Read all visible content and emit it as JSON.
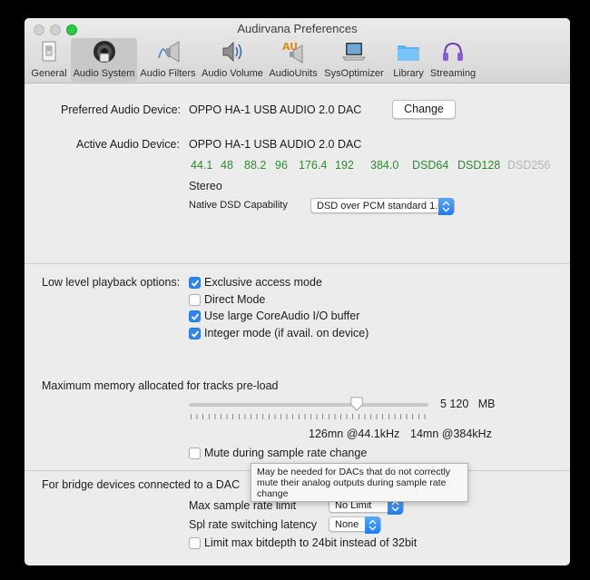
{
  "window": {
    "title": "Audirvana Preferences"
  },
  "tabs": [
    {
      "label": "General",
      "icon": "general-switch-icon",
      "selected": false
    },
    {
      "label": "Audio System",
      "icon": "speaker-icon",
      "selected": true
    },
    {
      "label": "Audio Filters",
      "icon": "audio-filter-icon",
      "selected": false
    },
    {
      "label": "Audio Volume",
      "icon": "volume-icon",
      "selected": false
    },
    {
      "label": "AudioUnits",
      "icon": "audio-units-icon",
      "selected": false
    },
    {
      "label": "SysOptimizer",
      "icon": "laptop-icon",
      "selected": false
    },
    {
      "label": "Library",
      "icon": "folder-icon",
      "selected": false
    },
    {
      "label": "Streaming",
      "icon": "headphones-icon",
      "selected": false
    }
  ],
  "device": {
    "preferred_label": "Preferred Audio Device:",
    "preferred_value": "OPPO HA-1 USB AUDIO 2.0 DAC",
    "change_label": "Change",
    "active_label": "Active Audio Device:",
    "active_value": "OPPO HA-1 USB AUDIO 2.0 DAC",
    "sample_rates": [
      {
        "label": "44.1",
        "supported": true
      },
      {
        "label": "48",
        "supported": true
      },
      {
        "label": "88.2",
        "supported": true
      },
      {
        "label": "96",
        "supported": true
      },
      {
        "label": "176.4",
        "supported": true
      },
      {
        "label": "192",
        "supported": true
      },
      {
        "label": "384.0",
        "supported": true
      },
      {
        "label": "DSD64",
        "supported": true
      },
      {
        "label": "DSD128",
        "supported": true
      },
      {
        "label": "DSD256",
        "supported": false
      }
    ],
    "channels": "Stereo",
    "dsd_label": "Native DSD Capability",
    "dsd_value": "DSD over PCM standard 1.0"
  },
  "playback": {
    "label": "Low level playback options:",
    "options": [
      {
        "label": "Exclusive access mode",
        "checked": true
      },
      {
        "label": "Direct Mode",
        "checked": false
      },
      {
        "label": "Use large CoreAudio I/O buffer",
        "checked": true
      },
      {
        "label": "Integer mode (if avail. on device)",
        "checked": true
      }
    ]
  },
  "memory": {
    "label": "Maximum memory allocated for tracks pre-load",
    "value": "5 120",
    "unit": "MB",
    "slider_fraction": 0.7,
    "duration_441": "126mn @44.1kHz",
    "duration_384": "14mn @384kHz",
    "mute_label": "Mute during sample rate change",
    "mute_checked": false
  },
  "tooltip": {
    "text": "May be needed for DACs that do not correctly mute their analog outputs during sample rate change"
  },
  "bridge": {
    "label": "For bridge devices connected to a DAC",
    "max_rate_label": "Max sample rate limit",
    "max_rate_value": "No Limit",
    "latency_label": "Spl rate switching latency",
    "latency_value": "None",
    "bitdepth_label": "Limit max bitdepth to 24bit instead of 32bit",
    "bitdepth_checked": false
  },
  "colors": {
    "accent": "#2f86f1",
    "supported_rate": "#2e8b2e",
    "unsupported_rate": "#b4b4b4"
  }
}
